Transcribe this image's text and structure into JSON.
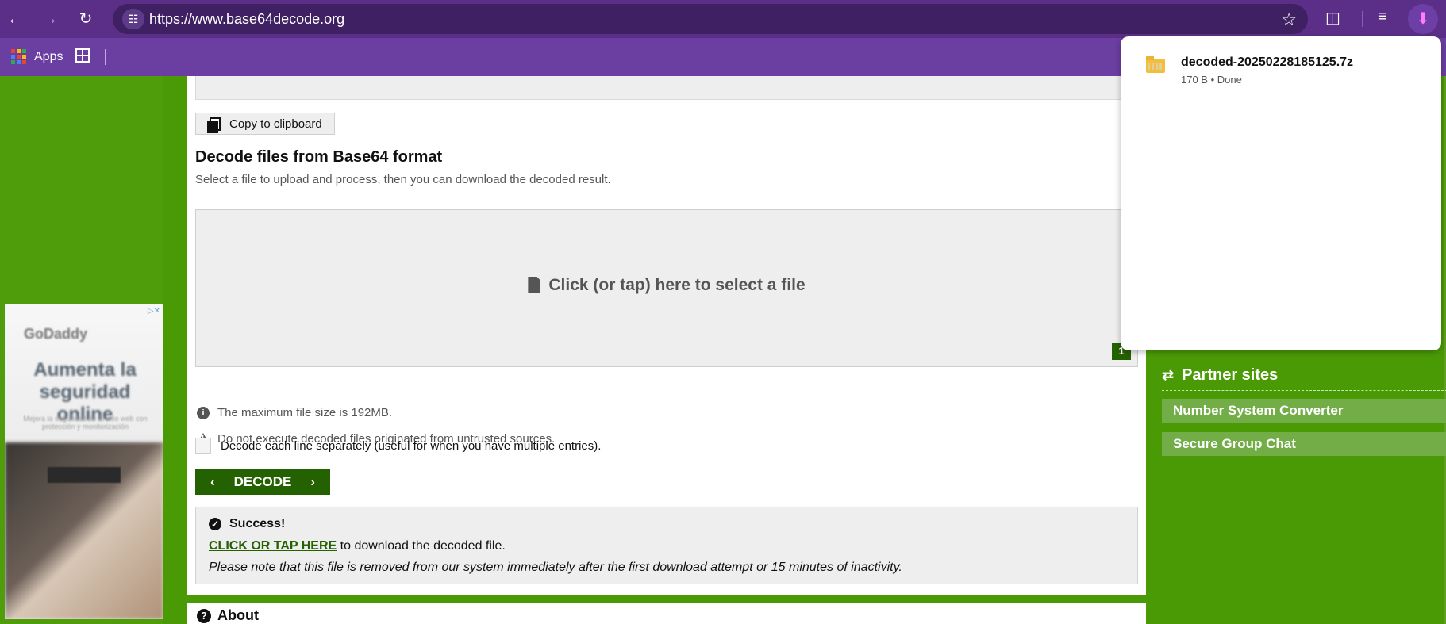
{
  "browser": {
    "url": "https://www.base64decode.org",
    "bookmarks": {
      "apps_label": "Apps"
    }
  },
  "ad": {
    "logo_text": "GoDaddy",
    "heading": "Aumenta la seguridad online",
    "small_text": "Mejora la seguridad de tu sitio web con protección y monitorización"
  },
  "main": {
    "copy_button": "Copy to clipboard",
    "section_title": "Decode files from Base64 format",
    "section_description": "Select a file to upload and process, then you can download the decoded result.",
    "dropzone_text": "Click (or tap) here to select a file",
    "dropzone_badge": "1",
    "max_size_text": "The maximum file size is 192MB.",
    "warning_text": "Do not execute decoded files originated from untrusted sources.",
    "checkbox_label": "Decode each line separately (useful for when you have multiple entries).",
    "decode_button": "DECODE",
    "success": {
      "title": "Success!",
      "link_text": "CLICK OR TAP HERE",
      "link_suffix": " to download the decoded file.",
      "note": "Please note that this file is removed from our system immediately after the first download attempt or 15 minutes of inactivity."
    },
    "about_title": "About"
  },
  "sidebar": {
    "partner_title": "Partner sites",
    "links": [
      "Number System Converter",
      "Secure Group Chat"
    ]
  },
  "download_popup": {
    "filename": "decoded-20250228185125.7z",
    "meta": "170 B • Done"
  },
  "colors": {
    "browser_purple": "#5b2f87",
    "page_green": "#4a9a06",
    "button_green": "#246100"
  }
}
